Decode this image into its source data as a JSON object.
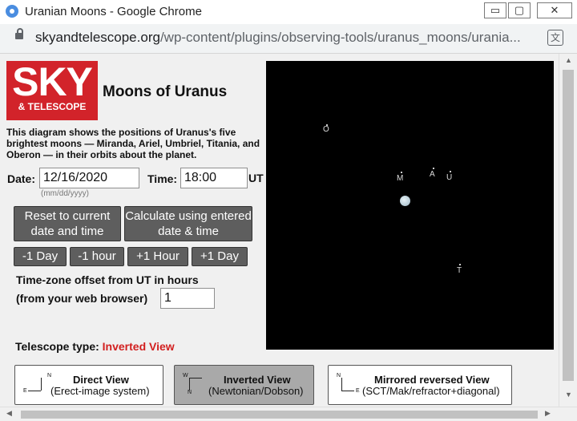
{
  "window": {
    "title": "Uranian Moons - Google Chrome",
    "minimize": "▭",
    "maximize": "▢",
    "close": "✕"
  },
  "address": {
    "domain": "skyandtelescope.org",
    "path": "/wp-content/plugins/observing-tools/uranus_moons/urania..."
  },
  "logo": {
    "top": "SKY",
    "bottom": "& TELESCOPE"
  },
  "page": {
    "title": "Moons of Uranus",
    "description": "This diagram shows the positions of Uranus's five brightest moons — Miranda, Ariel, Umbriel, Titania, and Oberon — in their orbits about the planet."
  },
  "form": {
    "date_label": "Date:",
    "date_value": "12/16/2020",
    "date_hint": "(mm/dd/yyyy)",
    "time_label": "Time:",
    "time_value": "18:00",
    "ut_label": "UT",
    "reset_button": "Reset to current date and time",
    "calculate_button": "Calculate using entered date & time",
    "minus_day": "-1 Day",
    "minus_hour": "-1 hour",
    "plus_hour": "+1 Hour",
    "plus_day": "+1 Day",
    "tz_label_1": "Time-zone offset from UT in hours",
    "tz_label_2": "(from your web browser)",
    "tz_value": "1"
  },
  "telescope": {
    "label": "Telescope type:",
    "current": "Inverted View",
    "views": [
      {
        "name": "Direct View",
        "sub": "(Erect-image system)",
        "selected": false,
        "n": "N",
        "e": "E"
      },
      {
        "name": "Inverted View",
        "sub": "(Newtonian/Dobson)",
        "selected": true,
        "n": "W",
        "e": "N"
      },
      {
        "name": "Mirrored reversed View",
        "sub": "(SCT/Mak/refractor+diagonal)",
        "selected": false,
        "n": "N",
        "e": "E"
      }
    ]
  },
  "moons": {
    "oberon": "O",
    "miranda": "M",
    "ariel": "A",
    "umbriel": "U",
    "titania": "T"
  },
  "colors": {
    "logo_red": "#d2232a",
    "button_gray": "#5e5e5e",
    "accent_red": "#d21f1f",
    "sky_black": "#000000"
  }
}
